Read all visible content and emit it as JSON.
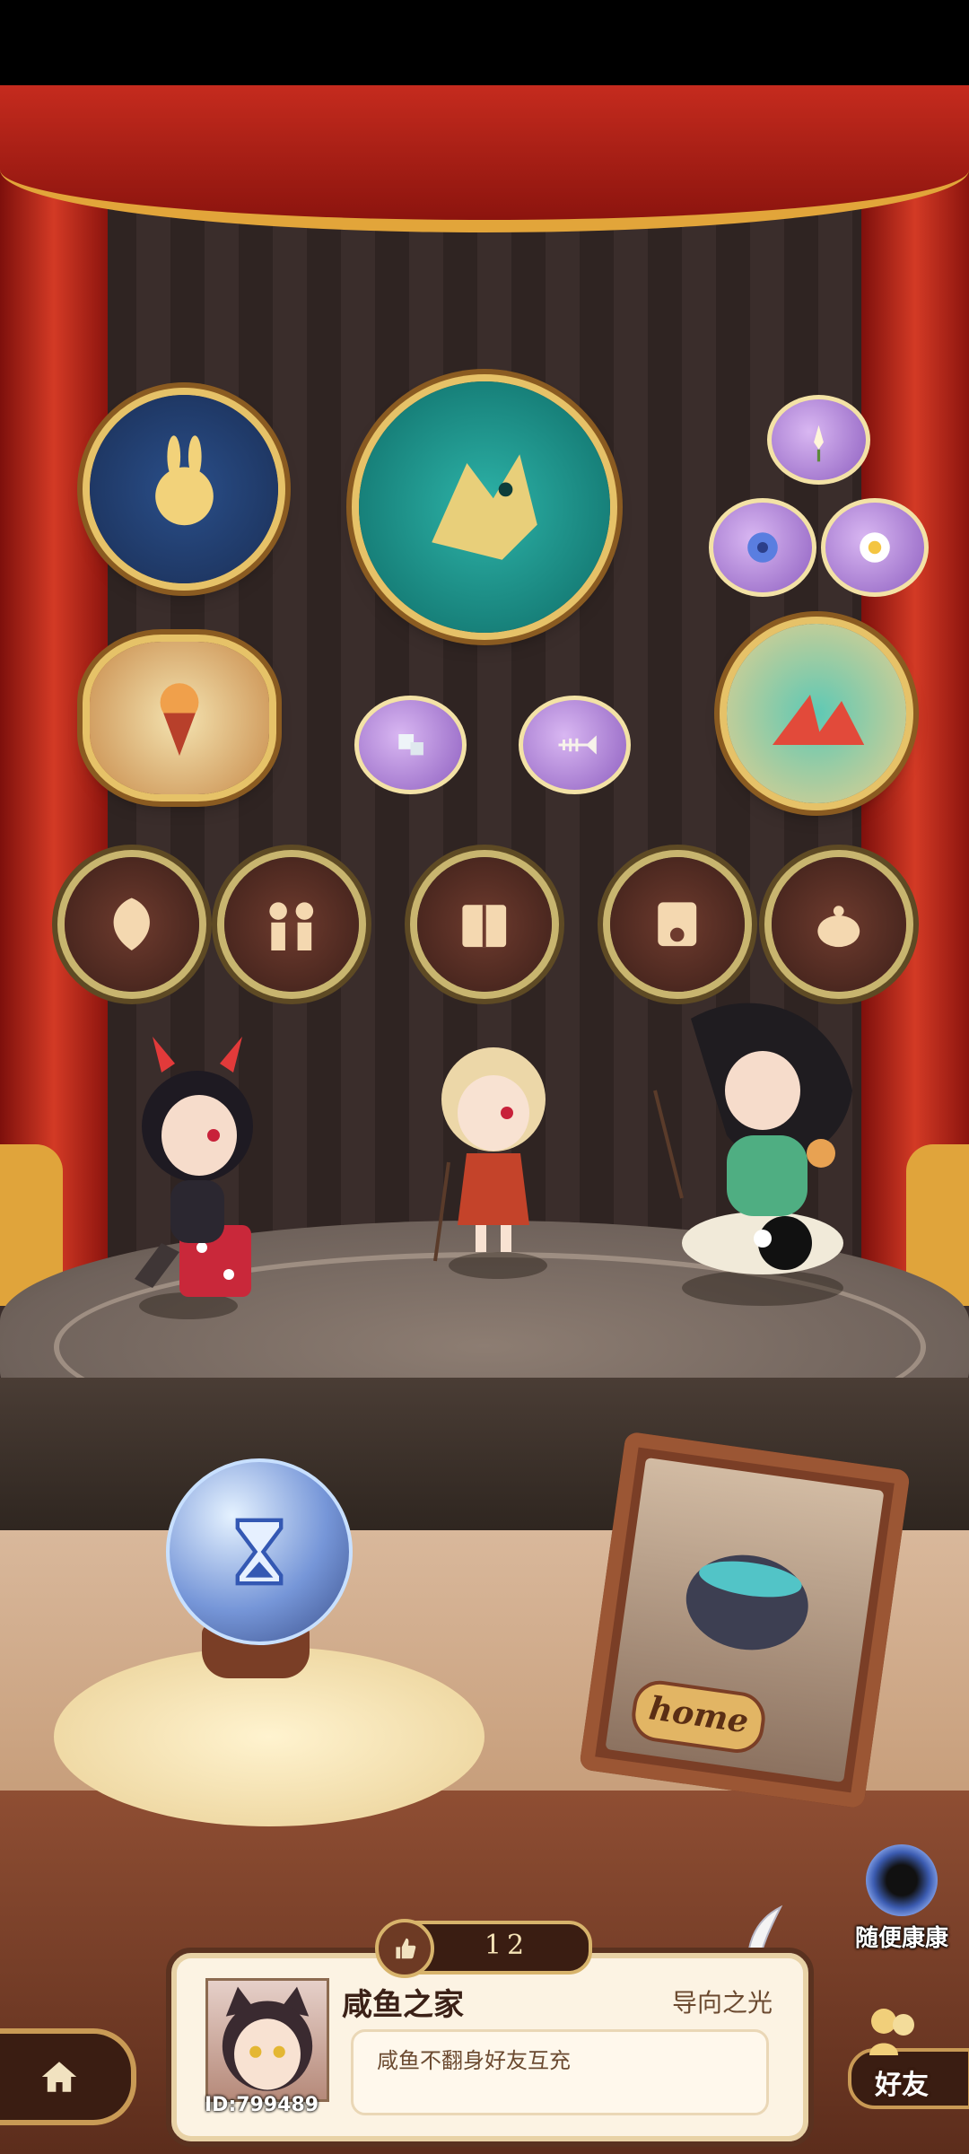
{
  "scene": {
    "crystal_icon": "hourglass-icon",
    "frame_label": "home"
  },
  "random_visit": {
    "label": "随便康康",
    "icon": "portal-icon"
  },
  "likes": {
    "count": "12",
    "icon": "thumbs-up-icon"
  },
  "profile": {
    "home_name": "咸鱼之家",
    "guild_name": "导向之光",
    "signature": "咸鱼不翻身好友互充",
    "user_id": "ID:799489"
  },
  "friends": {
    "label": "好友"
  },
  "nav": {
    "home_icon": "home-icon"
  },
  "colors": {
    "curtain": "#c52b1e",
    "gold": "#e6c268",
    "wood": "#7a3e26",
    "card": "#fcf3e3"
  }
}
